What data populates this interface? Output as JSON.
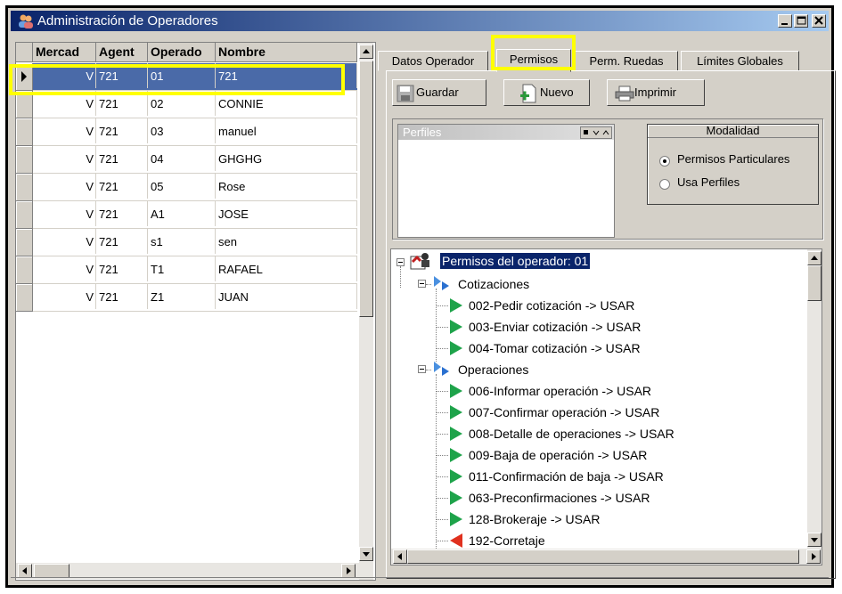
{
  "window": {
    "title": "Administración de Operadores",
    "title_color": "#0a246a",
    "icon": "users-icon"
  },
  "grid": {
    "columns": [
      "Mercad",
      "Agent",
      "Operado",
      "Nombre"
    ],
    "rows": [
      {
        "mercado": "V",
        "agente": "721",
        "operador": "01",
        "nombre": "721"
      },
      {
        "mercado": "V",
        "agente": "721",
        "operador": "02",
        "nombre": "CONNIE"
      },
      {
        "mercado": "V",
        "agente": "721",
        "operador": "03",
        "nombre": "manuel"
      },
      {
        "mercado": "V",
        "agente": "721",
        "operador": "04",
        "nombre": "GHGHG"
      },
      {
        "mercado": "V",
        "agente": "721",
        "operador": "05",
        "nombre": "Rose"
      },
      {
        "mercado": "V",
        "agente": "721",
        "operador": "A1",
        "nombre": "JOSE"
      },
      {
        "mercado": "V",
        "agente": "721",
        "operador": "s1",
        "nombre": "sen"
      },
      {
        "mercado": "V",
        "agente": "721",
        "operador": "T1",
        "nombre": "RAFAEL"
      },
      {
        "mercado": "V",
        "agente": "721",
        "operador": "Z1",
        "nombre": "JUAN"
      }
    ],
    "selected_row": 0,
    "selection_color": "#4a6aa8"
  },
  "tabs": [
    {
      "label": "Datos Operador",
      "active": false
    },
    {
      "label": "Permisos",
      "active": true
    },
    {
      "label": "Perm. Ruedas",
      "active": false
    },
    {
      "label": "Límites Globales",
      "active": false
    }
  ],
  "toolbar": {
    "save_label": "Guardar",
    "new_label": "Nuevo",
    "print_label": "Imprimir"
  },
  "perfiles": {
    "label": "Perfiles"
  },
  "modalidad": {
    "title": "Modalidad",
    "options": [
      {
        "label": "Permisos Particulares",
        "selected": true
      },
      {
        "label": "Usa Perfiles",
        "selected": false
      }
    ]
  },
  "tree": {
    "root": "Permisos del operador: 01",
    "groups": [
      {
        "label": "Cotizaciones",
        "items": [
          "002-Pedir cotización -> USAR",
          "003-Enviar cotización -> USAR",
          "004-Tomar cotización -> USAR"
        ]
      },
      {
        "label": "Operaciones",
        "items": [
          "006-Informar operación -> USAR",
          "007-Confirmar operación -> USAR",
          "008-Detalle de operaciones -> USAR",
          "009-Baja de operación -> USAR",
          "011-Confirmación de baja -> USAR",
          "063-Preconfirmaciones -> USAR",
          "128-Brokeraje -> USAR",
          "192-Corretaje"
        ]
      }
    ]
  },
  "colors": {
    "highlight": "#ffff00",
    "allowed_icon": "#1ea34a",
    "denied_icon": "#e0301e",
    "face": "#d4d0c8"
  }
}
